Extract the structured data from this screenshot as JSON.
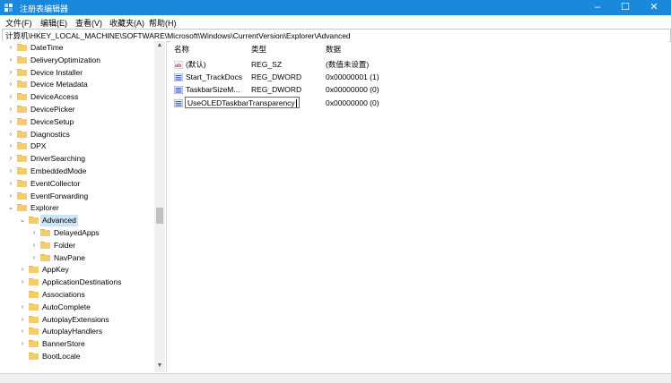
{
  "window": {
    "title": "注册表编辑器",
    "minimize_glyph": "–",
    "maximize_glyph": "☐",
    "close_glyph": "✕"
  },
  "menu": [
    "文件(F)",
    "编辑(E)",
    "查看(V)",
    "收藏夹(A)",
    "帮助(H)"
  ],
  "address": "计算机\\HKEY_LOCAL_MACHINE\\SOFTWARE\\Microsoft\\Windows\\CurrentVersion\\Explorer\\Advanced",
  "tree": {
    "items": [
      {
        "label": "DateTime",
        "depth": 0,
        "expand": "›"
      },
      {
        "label": "DeliveryOptimization",
        "depth": 0,
        "expand": "›"
      },
      {
        "label": "Device Installer",
        "depth": 0,
        "expand": "›"
      },
      {
        "label": "Device Metadata",
        "depth": 0,
        "expand": "›"
      },
      {
        "label": "DeviceAccess",
        "depth": 0,
        "expand": "›"
      },
      {
        "label": "DevicePicker",
        "depth": 0,
        "expand": "›"
      },
      {
        "label": "DeviceSetup",
        "depth": 0,
        "expand": "›"
      },
      {
        "label": "Diagnostics",
        "depth": 0,
        "expand": "›"
      },
      {
        "label": "DPX",
        "depth": 0,
        "expand": "›"
      },
      {
        "label": "DriverSearching",
        "depth": 0,
        "expand": "›"
      },
      {
        "label": "EmbeddedMode",
        "depth": 0,
        "expand": "›"
      },
      {
        "label": "EventCollector",
        "depth": 0,
        "expand": "›"
      },
      {
        "label": "EventForwarding",
        "depth": 0,
        "expand": "›"
      },
      {
        "label": "Explorer",
        "depth": 0,
        "expand": "⌄"
      },
      {
        "label": "Advanced",
        "depth": 1,
        "expand": "⌄",
        "selected": true
      },
      {
        "label": "DelayedApps",
        "depth": 2,
        "expand": "›"
      },
      {
        "label": "Folder",
        "depth": 2,
        "expand": "›"
      },
      {
        "label": "NavPane",
        "depth": 2,
        "expand": "›"
      },
      {
        "label": "AppKey",
        "depth": 1,
        "expand": "›"
      },
      {
        "label": "ApplicationDestinations",
        "depth": 1,
        "expand": "›"
      },
      {
        "label": "Associations",
        "depth": 1,
        "expand": ""
      },
      {
        "label": "AutoComplete",
        "depth": 1,
        "expand": "›"
      },
      {
        "label": "AutoplayExtensions",
        "depth": 1,
        "expand": "›"
      },
      {
        "label": "AutoplayHandlers",
        "depth": 1,
        "expand": "›"
      },
      {
        "label": "BannerStore",
        "depth": 1,
        "expand": "›"
      },
      {
        "label": "BootLocale",
        "depth": 1,
        "expand": ""
      }
    ],
    "scroll_up": "▲",
    "scroll_down": "▼"
  },
  "values": {
    "columns": {
      "name": "名称",
      "type": "类型",
      "data": "数据"
    },
    "rows": [
      {
        "icon": "string-value-icon",
        "name": "(默认)",
        "type": "REG_SZ",
        "data": "(数值未设置)"
      },
      {
        "icon": "binary-value-icon",
        "name": "Start_TrackDocs",
        "type": "REG_DWORD",
        "data": "0x00000001 (1)"
      },
      {
        "icon": "binary-value-icon",
        "name": "TaskbarSizeM...",
        "type": "REG_DWORD",
        "data": "0x00000000 (0)"
      },
      {
        "icon": "binary-value-icon",
        "name": "UseOLEDTaskbarTransparency",
        "type": "",
        "data": "0x00000000 (0)",
        "editing": true
      }
    ]
  },
  "colors": {
    "titlebar": "#1a88db",
    "selection": "#cce4f7",
    "folder": "#f4cd6b"
  }
}
